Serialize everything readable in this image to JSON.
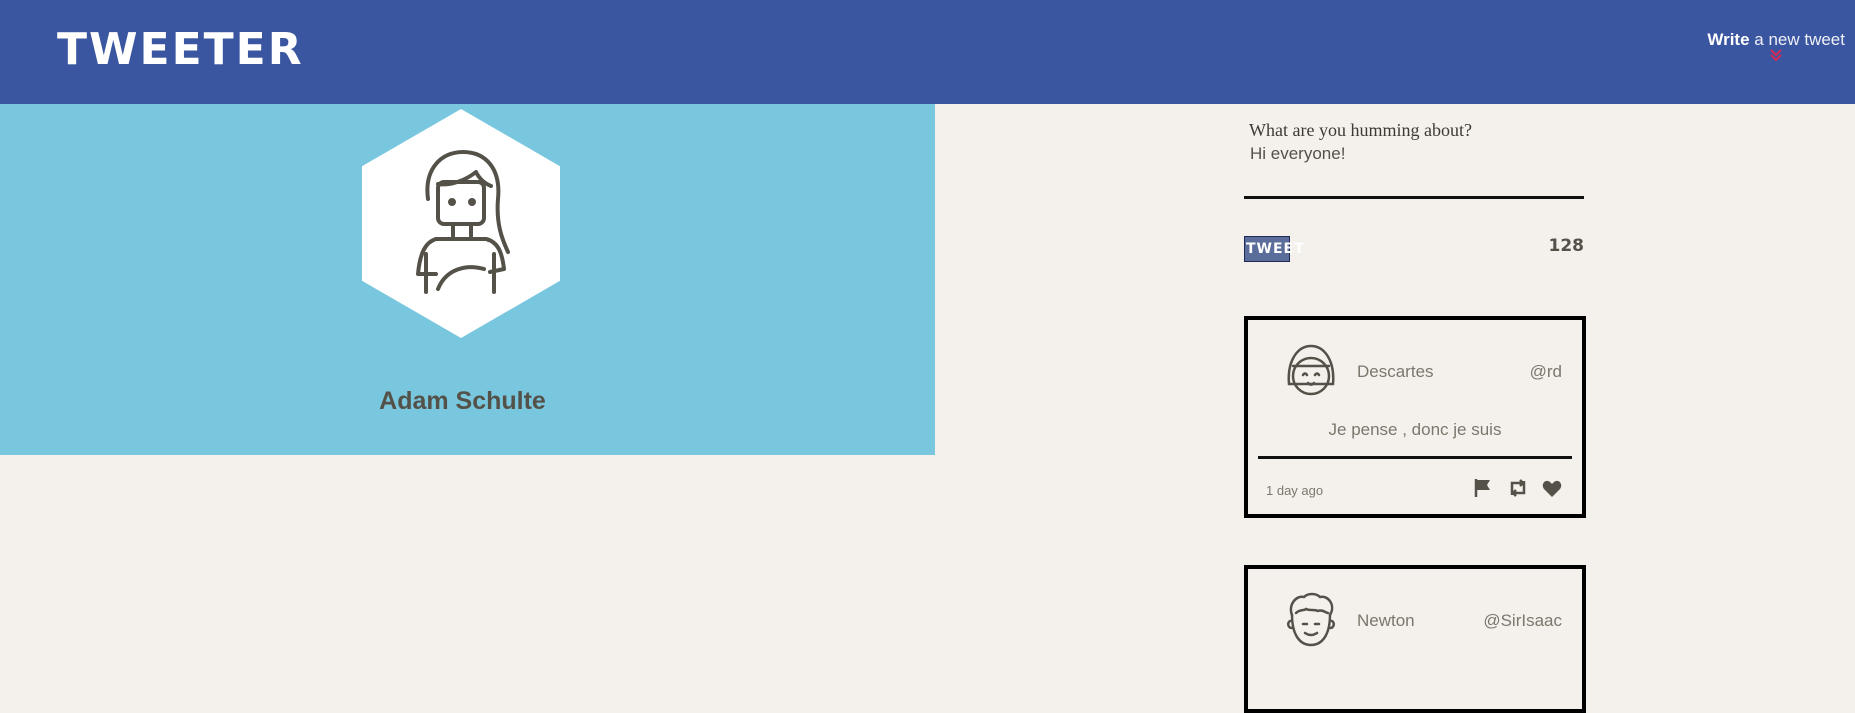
{
  "header": {
    "logo": "TWEETER",
    "compose_bold": "Write",
    "compose_rest": " a new tweet",
    "compose_chevron": "»"
  },
  "profile": {
    "name": "Adam Schulte",
    "avatar_icon": "girl-avatar-icon",
    "banner_color": "#79c6df"
  },
  "composer": {
    "label": "What are you humming about?",
    "text": "Hi everyone!",
    "button_label": "TWEET",
    "counter": "128"
  },
  "tweets": [
    {
      "name": "Descartes",
      "handle": "@rd",
      "body": "Je pense , donc je suis",
      "time": "1 day ago",
      "avatar_icon": "bob-hair-avatar-icon"
    },
    {
      "name": "Newton",
      "handle": "@SirIsaac",
      "avatar_icon": "curly-hair-avatar-icon"
    }
  ],
  "colors": {
    "nav": "#3b56a0",
    "accent": "#d22a57",
    "background": "#f4f1ec"
  }
}
